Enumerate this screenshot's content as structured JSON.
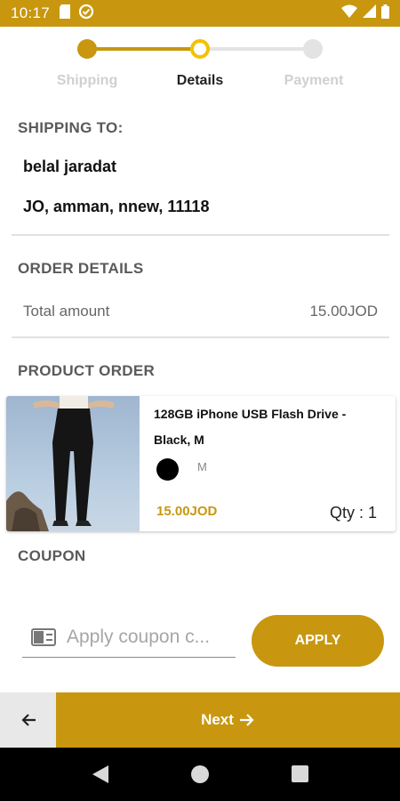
{
  "status_bar": {
    "time": "10:17"
  },
  "stepper": {
    "steps": [
      {
        "label": "Shipping"
      },
      {
        "label": "Details"
      },
      {
        "label": "Payment"
      }
    ]
  },
  "shipping": {
    "title": "SHIPPING TO:",
    "name": "belal jaradat",
    "address": "JO, amman, nnew, 11118"
  },
  "order_details": {
    "title": "ORDER DETAILS",
    "total_label": "Total amount",
    "total_value": "15.00JOD"
  },
  "product_order": {
    "title": "PRODUCT ORDER",
    "item": {
      "name": "128GB iPhone USB Flash Drive - Black, M",
      "color": "#000000",
      "size": "M",
      "price": "15.00JOD",
      "qty": "Qty : 1"
    }
  },
  "coupon": {
    "title": "COUPON",
    "placeholder": "Apply coupon c...",
    "apply_label": "APPLY"
  },
  "footer": {
    "next_label": "Next"
  },
  "colors": {
    "accent": "#c8970f",
    "active_step": "#f2c200"
  }
}
